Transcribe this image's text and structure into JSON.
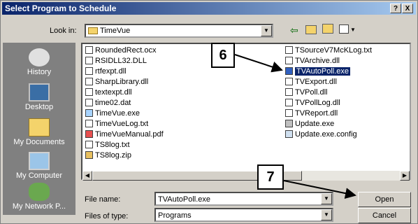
{
  "window": {
    "title": "Select Program to Schedule",
    "help_label": "?",
    "close_label": "X"
  },
  "lookin": {
    "label": "Look in:",
    "value": "TimeVue"
  },
  "places": [
    {
      "label": "History"
    },
    {
      "label": "Desktop"
    },
    {
      "label": "My Documents"
    },
    {
      "label": "My Computer"
    },
    {
      "label": "My Network P..."
    }
  ],
  "files": {
    "col1": [
      "RoundedRect.ocx",
      "RSIDLL32.DLL",
      "rtfexpt.dll",
      "SharpLibrary.dll",
      "textexpt.dll",
      "time02.dat",
      "TimeVue.exe",
      "TimeVueLog.txt",
      "TimeVueManual.pdf",
      "TS8log.txt",
      "TS8log.zip"
    ],
    "col2": [
      "TSourceV7McKLog.txt",
      "TVArchive.dll",
      "TVAutoPoll.exe",
      "TVExport.dll",
      "TVPoll.dll",
      "TVPollLog.dll",
      "TVReport.dll",
      "Update.exe",
      "Update.exe.config"
    ],
    "selected": "TVAutoPoll.exe"
  },
  "filename": {
    "label": "File name:",
    "value": "TVAutoPoll.exe"
  },
  "filetype": {
    "label": "Files of type:",
    "value": "Programs"
  },
  "buttons": {
    "open": "Open",
    "cancel": "Cancel"
  },
  "callouts": {
    "first": "6",
    "second": "7"
  },
  "colors": {
    "title_bar": "#0a246a",
    "selection": "#0a246a",
    "arrow": "#000000"
  }
}
